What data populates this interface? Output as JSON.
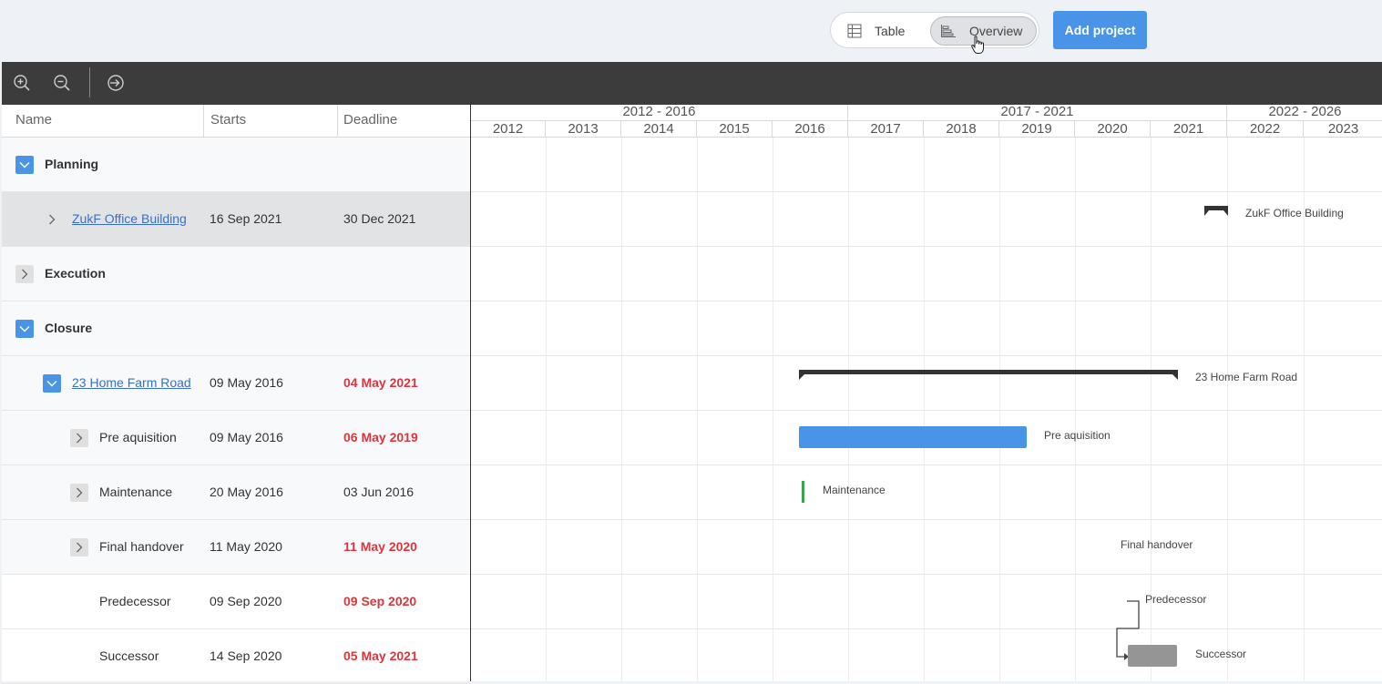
{
  "view_toggle": {
    "table_label": "Table",
    "overview_label": "Overview",
    "active": "Overview"
  },
  "add_project_label": "Add project",
  "toolbar": {
    "icons": [
      "zoom-in-icon",
      "zoom-out-icon",
      "export-icon"
    ]
  },
  "columns": {
    "name": "Name",
    "starts": "Starts",
    "deadline": "Deadline"
  },
  "timeline": {
    "periods": [
      "2012 - 2016",
      "2017 - 2021",
      "2022 - 2026"
    ],
    "years": [
      "2012",
      "2013",
      "2014",
      "2015",
      "2016",
      "2017",
      "2018",
      "2019",
      "2020",
      "2021",
      "2022",
      "2023"
    ]
  },
  "rows": [
    {
      "name": "Planning",
      "starts": "",
      "deadline": ""
    },
    {
      "name": "ZukF Office Building",
      "starts": "16 Sep 2021",
      "deadline": "30 Dec 2021"
    },
    {
      "name": "Execution",
      "starts": "",
      "deadline": ""
    },
    {
      "name": "Closure",
      "starts": "",
      "deadline": ""
    },
    {
      "name": "23 Home Farm Road",
      "starts": "09 May 2016",
      "deadline": "04 May 2021"
    },
    {
      "name": "Pre aquisition",
      "starts": "09 May 2016",
      "deadline": "06 May 2019"
    },
    {
      "name": "Maintenance",
      "starts": "20 May 2016",
      "deadline": "03 Jun 2016"
    },
    {
      "name": "Final handover",
      "starts": "11 May 2020",
      "deadline": "11 May 2020"
    },
    {
      "name": "Predecessor",
      "starts": "09 Sep 2020",
      "deadline": "09 Sep 2020"
    },
    {
      "name": "Successor",
      "starts": "14 Sep 2020",
      "deadline": "05 May 2021"
    }
  ],
  "bar_labels": {
    "zukf": "ZukF Office Building",
    "home_farm": "23 Home Farm Road",
    "pre_aquisition": "Pre aquisition",
    "maintenance": "Maintenance",
    "final_handover": "Final handover",
    "predecessor": "Predecessor",
    "successor": "Successor"
  },
  "colors": {
    "accent": "#4a94e8",
    "overdue": "#d9363e",
    "milestone": "#3aa24a",
    "toolbar": "#3c3c3c"
  }
}
